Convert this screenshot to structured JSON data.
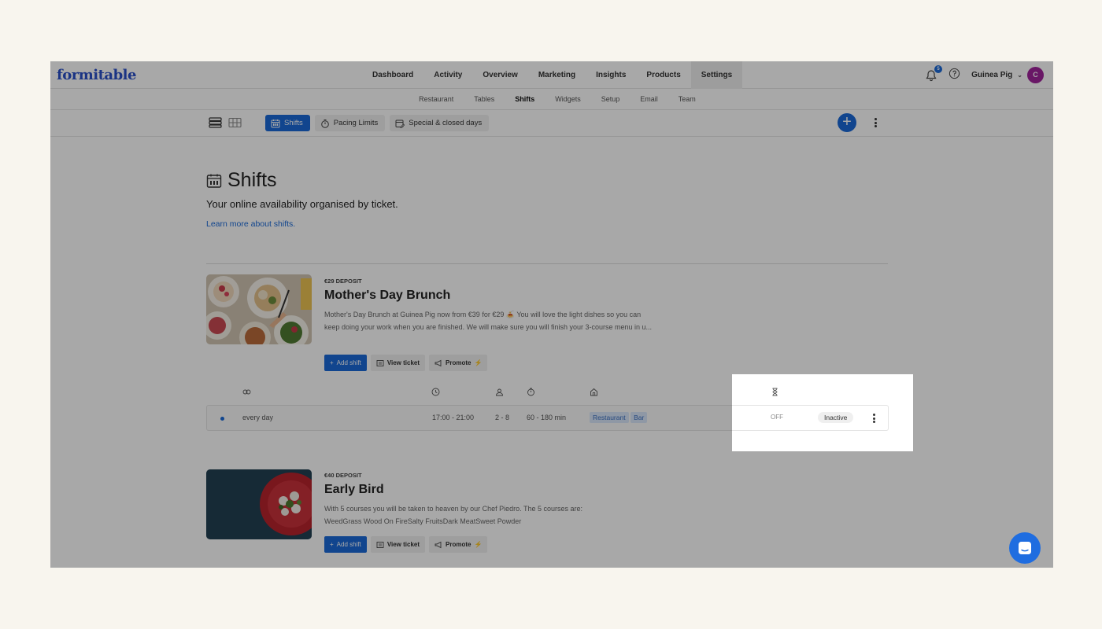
{
  "app": {
    "logo_text": "formitable",
    "brand_color": "#2a50c8",
    "accent_color": "#1a6ad8"
  },
  "nav": {
    "items": [
      "Dashboard",
      "Activity",
      "Overview",
      "Marketing",
      "Insights",
      "Products",
      "Settings"
    ],
    "active": "Settings"
  },
  "header": {
    "notification_count": "5",
    "user_name": "Guinea Pig",
    "avatar_initial": "C",
    "avatar_color": "#a0239b"
  },
  "subnav": {
    "items": [
      "Restaurant",
      "Tables",
      "Shifts",
      "Widgets",
      "Setup",
      "Email",
      "Team"
    ],
    "active": "Shifts"
  },
  "toolbar": {
    "tabs": [
      {
        "label": "Shifts",
        "icon": "calendar-icon",
        "active": true
      },
      {
        "label": "Pacing Limits",
        "icon": "stopwatch-icon",
        "active": false
      },
      {
        "label": "Special & closed days",
        "icon": "calendar-edit-icon",
        "active": false
      }
    ],
    "add_label": "+"
  },
  "page": {
    "title": "Shifts",
    "subtitle": "Your online availability organised by ticket.",
    "learn_more": "Learn more about shifts."
  },
  "shifts": [
    {
      "deposit": "€29 DEPOSIT",
      "name": "Mother's Day Brunch",
      "description": "Mother's Day Brunch at Guinea Pig now from €39 for €29 🍝 You will love the light dishes so you can keep doing your work when you are finished. We will make sure you will finish your 3-course menu in u...",
      "buttons": {
        "add": "Add shift",
        "view": "View ticket",
        "promote": "Promote"
      },
      "schedule": {
        "days": "every day",
        "time": "17:00 - 21:00",
        "guests": "2 - 8",
        "duration": "60 - 180 min",
        "areas": [
          "Restaurant",
          "Bar"
        ],
        "waitlist": "OFF",
        "status": "Inactive"
      }
    },
    {
      "deposit": "€40 DEPOSIT",
      "name": "Early Bird",
      "description": "With 5 courses you will be taken to heaven by our Chef Piedro. The 5 courses are: WeedGrass Wood On FireSalty FruitsDark MeatSweet Powder",
      "buttons": {
        "add": "Add shift",
        "view": "View ticket",
        "promote": "Promote"
      }
    }
  ]
}
